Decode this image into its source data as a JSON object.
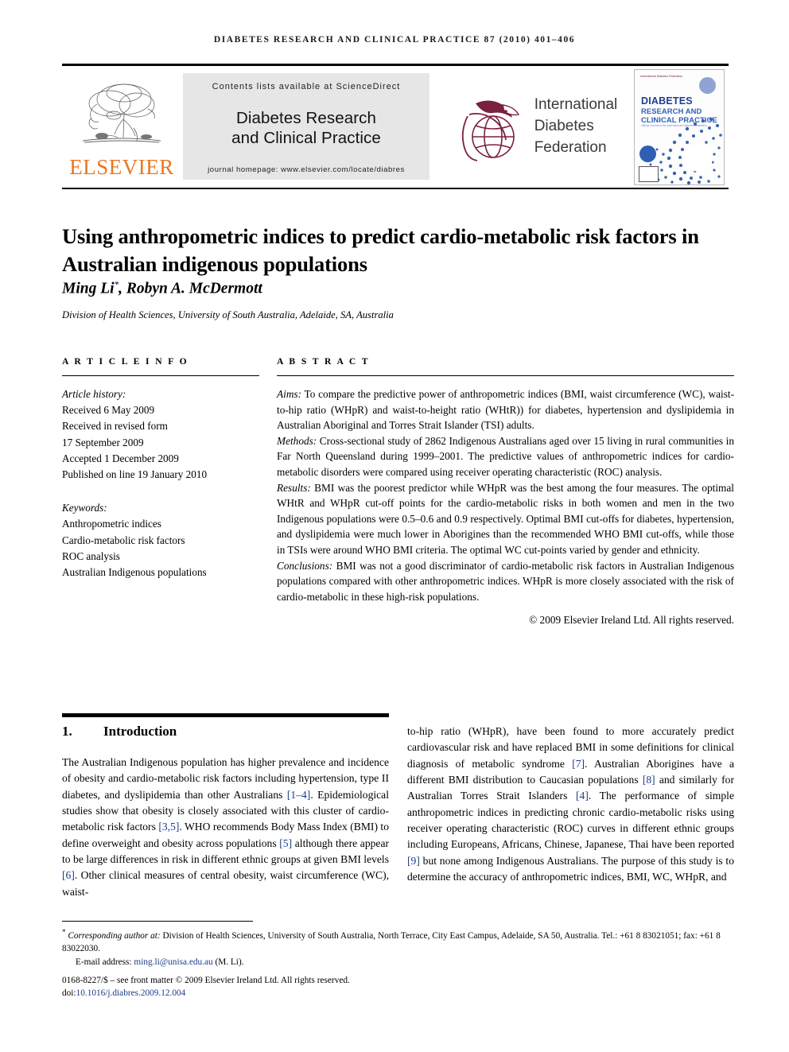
{
  "running_head": "DIABETES RESEARCH AND CLINICAL PRACTICE 87 (2010) 401–406",
  "masthead": {
    "publisher_logo_name": "elsevier-tree-logo",
    "publisher_wordmark": "ELSEVIER",
    "banner": {
      "contents_line": "Contents lists available at ScienceDirect",
      "journal_title_line1": "Diabetes Research",
      "journal_title_line2": "and Clinical Practice",
      "homepage_line": "journal homepage: www.elsevier.com/locate/diabres"
    },
    "society": {
      "logo_name": "idf-bird-globe-logo",
      "line1": "International",
      "line2": "Diabetes",
      "line3": "Federation"
    },
    "cover": {
      "society_mark": "International Diabetes Federation",
      "title_line1": "DIABETES",
      "title_line2": "RESEARCH AND CLINICAL PRACTICE",
      "subtitle": "Official Journal of the International Diabetes Federation"
    }
  },
  "article": {
    "title": "Using anthropometric indices to predict cardio-metabolic risk factors in Australian indigenous populations",
    "authors": "Ming Li",
    "authors_rest": ", Robyn A. McDermott",
    "corresponding_marker": "*",
    "affiliation": "Division of Health Sciences, University of South Australia, Adelaide, SA, Australia"
  },
  "info": {
    "heading": "A R T I C L E   I N F O",
    "history_label": "Article history:",
    "history": [
      "Received 6 May 2009",
      "Received in revised form",
      "17 September 2009",
      "Accepted 1 December 2009",
      "Published on line 19 January 2010"
    ],
    "keywords_label": "Keywords:",
    "keywords": [
      "Anthropometric indices",
      "Cardio-metabolic risk factors",
      "ROC analysis",
      "Australian Indigenous populations"
    ]
  },
  "abstract": {
    "heading": "A B S T R A C T",
    "aims_label": "Aims:",
    "aims_text": " To compare the predictive power of anthropometric indices (BMI, waist circumference (WC), waist-to-hip ratio (WHpR) and waist-to-height ratio (WHtR)) for diabetes, hypertension and dyslipidemia in Australian Aboriginal and Torres Strait Islander (TSI) adults.",
    "methods_label": "Methods:",
    "methods_text": " Cross-sectional study of 2862 Indigenous Australians aged over 15 living in rural communities in Far North Queensland during 1999–2001. The predictive values of anthropometric indices for cardio-metabolic disorders were compared using receiver operating characteristic (ROC) analysis.",
    "results_label": "Results:",
    "results_text": " BMI was the poorest predictor while WHpR was the best among the four measures. The optimal WHtR and WHpR cut-off points for the cardio-metabolic risks in both women and men in the two Indigenous populations were 0.5–0.6 and 0.9 respectively. Optimal BMI cut-offs for diabetes, hypertension, and dyslipidemia were much lower in Aborigines than the recommended WHO BMI cut-offs, while those in TSIs were around WHO BMI criteria. The optimal WC cut-points varied by gender and ethnicity.",
    "conclusions_label": "Conclusions:",
    "conclusions_text": " BMI was not a good discriminator of cardio-metabolic risk factors in Australian Indigenous populations compared with other anthropometric indices. WHpR is more closely associated with the risk of cardio-metabolic in these high-risk populations.",
    "copyright": "© 2009 Elsevier Ireland Ltd. All rights reserved."
  },
  "body": {
    "section_number": "1.",
    "section_title": "Introduction",
    "left_paragraph": {
      "part1": "The Australian Indigenous population has higher prevalence and incidence of obesity and cardio-metabolic risk factors including hypertension, type II diabetes, and dyslipidemia than other Australians ",
      "cite1": "[1–4]",
      "part2": ". Epidemiological studies show that obesity is closely associated with this cluster of cardio-metabolic risk factors ",
      "cite2": "[3,5]",
      "part3": ". WHO recommends Body Mass Index (BMI) to define overweight and obesity across populations ",
      "cite3": "[5]",
      "part4": " although there appear to be large differences in risk in different ethnic groups at given BMI levels ",
      "cite4": "[6]",
      "part5": ". Other clinical measures of central obesity, waist circumference (WC), waist-"
    },
    "right_paragraph": {
      "part1": "to-hip ratio (WHpR), have been found to more accurately predict cardiovascular risk and have replaced BMI in some definitions for clinical diagnosis of metabolic syndrome ",
      "cite1": "[7]",
      "part2": ". Australian Aborigines have a different BMI distribution to Caucasian populations ",
      "cite2": "[8]",
      "part3": " and similarly for Australian Torres Strait Islanders ",
      "cite3": "[4]",
      "part4": ". The performance of simple anthropometric indices in predicting chronic cardio-metabolic risks using receiver operating characteristic (ROC) curves in different ethnic groups including Europeans, Africans, Chinese, Japanese, Thai have been reported ",
      "cite4": "[9]",
      "part5": " but none among Indigenous Australians. The purpose of this study is to determine the accuracy of anthropometric indices, BMI, WC, WHpR, and"
    }
  },
  "footnote": {
    "corr_label": "Corresponding author at:",
    "corr_text": " Division of Health Sciences, University of South Australia, North Terrace, City East Campus, Adelaide, SA 50, Australia. Tel.: +61 8 83021051; fax: +61 8 83022030.",
    "email_label": "E-mail address:",
    "email": "ming.li@unisa.edu.au",
    "email_suffix": " (M. Li).",
    "front_matter": "0168-8227/$ – see front matter © 2009 Elsevier Ireland Ltd. All rights reserved.",
    "doi_label": "doi:",
    "doi": "10.1016/j.diabres.2009.12.004"
  },
  "colors": {
    "elsevier_orange": "#E87722",
    "link_blue": "#1b3c8c",
    "idf_maroon": "#7a2040",
    "cover_blue": "#2f5fb5"
  }
}
